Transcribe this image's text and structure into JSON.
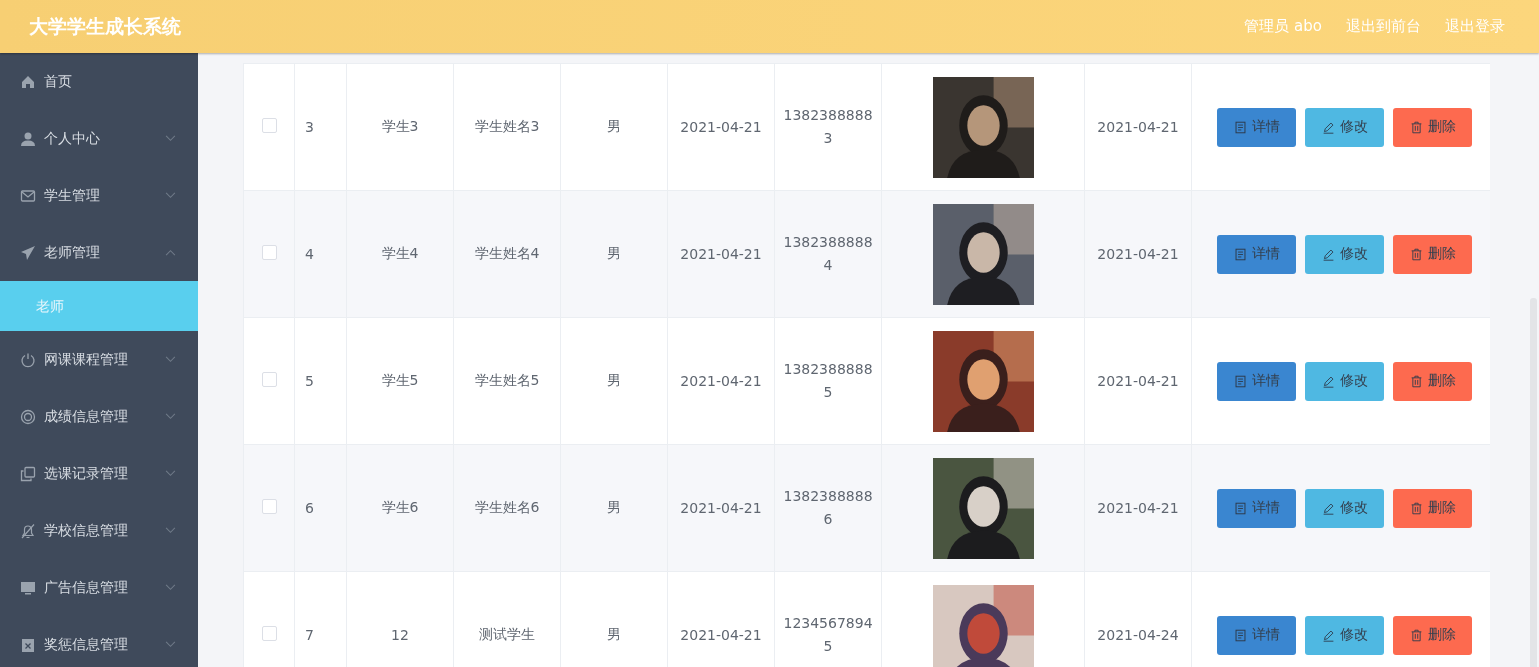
{
  "header": {
    "title": "大学学生成长系统",
    "user": "管理员 abo",
    "links": [
      "退出到前台",
      "退出登录"
    ]
  },
  "sidebar": {
    "items": [
      {
        "label": "首页"
      },
      {
        "label": "个人中心",
        "expanded": false
      },
      {
        "label": "学生管理",
        "expanded": false
      },
      {
        "label": "老师管理",
        "expanded": true,
        "children": [
          {
            "label": "老师",
            "selected": true
          }
        ]
      },
      {
        "label": "网课课程管理",
        "expanded": false
      },
      {
        "label": "成绩信息管理",
        "expanded": false
      },
      {
        "label": "选课记录管理",
        "expanded": false
      },
      {
        "label": "学校信息管理",
        "expanded": false
      },
      {
        "label": "广告信息管理",
        "expanded": false
      },
      {
        "label": "奖惩信息管理",
        "expanded": false
      }
    ]
  },
  "table": {
    "rows": [
      {
        "checked": false,
        "cells": [
          "3",
          "学生3",
          "学生姓名3",
          "男",
          "2021-04-21",
          "13823888883"
        ],
        "date": "2021-04-21",
        "actions": [
          {
            "kind": "detail",
            "label": "详情"
          },
          {
            "kind": "edit",
            "label": "修改"
          },
          {
            "kind": "delete",
            "label": "删除"
          }
        ]
      },
      {
        "checked": false,
        "cells": [
          "4",
          "学生4",
          "学生姓名4",
          "男",
          "2021-04-21",
          "13823888884"
        ],
        "date": "2021-04-21",
        "actions": [
          {
            "kind": "detail",
            "label": "详情"
          },
          {
            "kind": "edit",
            "label": "修改"
          },
          {
            "kind": "delete",
            "label": "删除"
          }
        ]
      },
      {
        "checked": false,
        "cells": [
          "5",
          "学生5",
          "学生姓名5",
          "男",
          "2021-04-21",
          "13823888885"
        ],
        "date": "2021-04-21",
        "actions": [
          {
            "kind": "detail",
            "label": "详情"
          },
          {
            "kind": "edit",
            "label": "修改"
          },
          {
            "kind": "delete",
            "label": "删除"
          }
        ]
      },
      {
        "checked": false,
        "cells": [
          "6",
          "学生6",
          "学生姓名6",
          "男",
          "2021-04-21",
          "13823888886"
        ],
        "date": "2021-04-21",
        "actions": [
          {
            "kind": "detail",
            "label": "详情"
          },
          {
            "kind": "edit",
            "label": "修改"
          },
          {
            "kind": "delete",
            "label": "删除"
          }
        ]
      },
      {
        "checked": false,
        "cells": [
          "7",
          "12",
          "测试学生",
          "男",
          "2021-04-21",
          "12345678945"
        ],
        "date": "2021-04-24",
        "actions": [
          {
            "kind": "detail",
            "label": "详情"
          },
          {
            "kind": "edit",
            "label": "修改"
          },
          {
            "kind": "delete",
            "label": "删除"
          }
        ]
      }
    ]
  }
}
